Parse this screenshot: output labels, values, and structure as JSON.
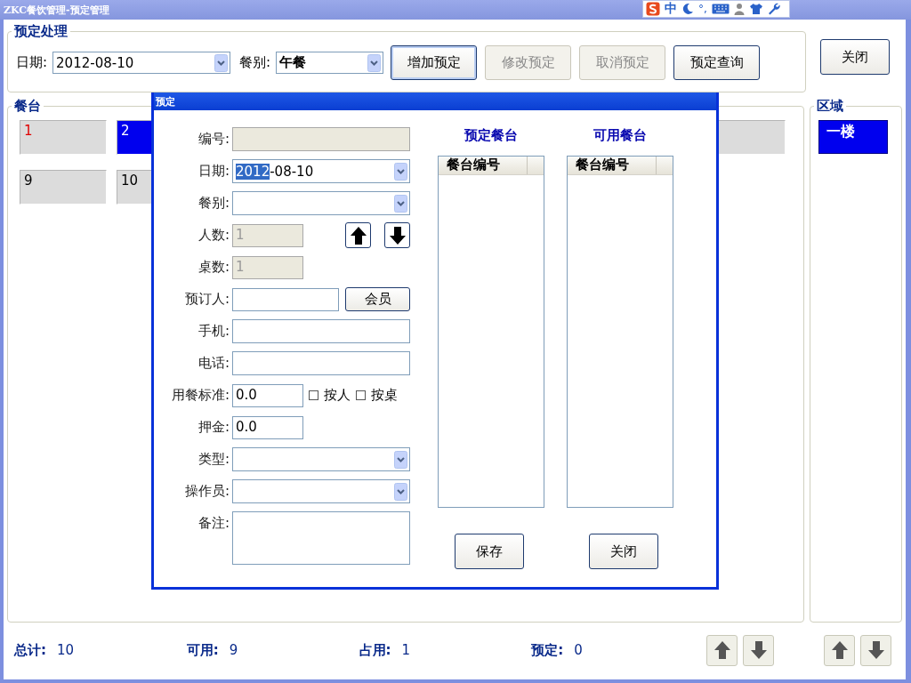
{
  "window": {
    "title": "ZKC餐饮管理-预定管理"
  },
  "ime_toolbar": {
    "mode": "中",
    "punct": "°,"
  },
  "booking_group": {
    "legend": "预定处理",
    "date": {
      "label": "日期:",
      "value": "2012-08-10"
    },
    "meal": {
      "label": "餐别:",
      "value": "午餐"
    },
    "buttons": [
      {
        "label": "增加预定",
        "disabled": false,
        "focused": true
      },
      {
        "label": "修改预定",
        "disabled": true,
        "focused": false
      },
      {
        "label": "取消预定",
        "disabled": true,
        "focused": false
      },
      {
        "label": "预定查询",
        "disabled": false,
        "focused": false
      }
    ]
  },
  "close_button": {
    "label": "关闭"
  },
  "tables_group": {
    "legend": "餐台",
    "tables": [
      {
        "label": "1",
        "occupied": true,
        "selected": false
      },
      {
        "label": "2",
        "occupied": false,
        "selected": true
      },
      {
        "kind": "covered"
      },
      {
        "label": "9",
        "occupied": false,
        "selected": false
      },
      {
        "label": "10",
        "occupied": false,
        "selected": false
      }
    ]
  },
  "region_group": {
    "legend": "区域",
    "items": [
      {
        "label": "一楼",
        "selected": true
      }
    ]
  },
  "stats": [
    {
      "label": "总计:",
      "value": "10"
    },
    {
      "label": "可用:",
      "value": "9"
    },
    {
      "label": "占用:",
      "value": "1"
    },
    {
      "label": "预定:",
      "value": "0"
    }
  ],
  "dialog": {
    "title": "预定",
    "fields": [
      {
        "kind": "text",
        "label": "编号:",
        "disabled": true
      },
      {
        "kind": "combo",
        "label": "日期:",
        "value_parts": [
          {
            "text": "2012",
            "selected": true
          },
          {
            "text": "-08-10",
            "selected": false
          }
        ]
      },
      {
        "kind": "combo",
        "label": "餐别:"
      },
      {
        "kind": "spin",
        "label": "人数:",
        "value": "1",
        "disabled": true
      },
      {
        "kind": "short",
        "label": "桌数:",
        "value": "1",
        "disabled": true
      },
      {
        "kind": "text_button",
        "label": "预订人:",
        "button": "会员"
      },
      {
        "kind": "text",
        "label": "手机:",
        "disabled": false
      },
      {
        "kind": "text",
        "label": "电话:",
        "disabled": false
      },
      {
        "kind": "checks",
        "label": "用餐标准:",
        "value": "0.0",
        "options": [
          {
            "label": "按人",
            "checked": false
          },
          {
            "label": "按桌",
            "checked": false
          }
        ]
      },
      {
        "kind": "short",
        "label": "押金:",
        "value": "0.0",
        "disabled": false
      },
      {
        "kind": "combo",
        "label": "类型:"
      },
      {
        "kind": "combo",
        "label": "操作员:"
      },
      {
        "kind": "memo",
        "label": "备注:"
      }
    ],
    "lists": [
      {
        "title": "预定餐台",
        "column": "餐台编号"
      },
      {
        "title": "可用餐台",
        "column": "餐台编号"
      }
    ],
    "buttons": [
      "保存",
      "关闭"
    ]
  }
}
